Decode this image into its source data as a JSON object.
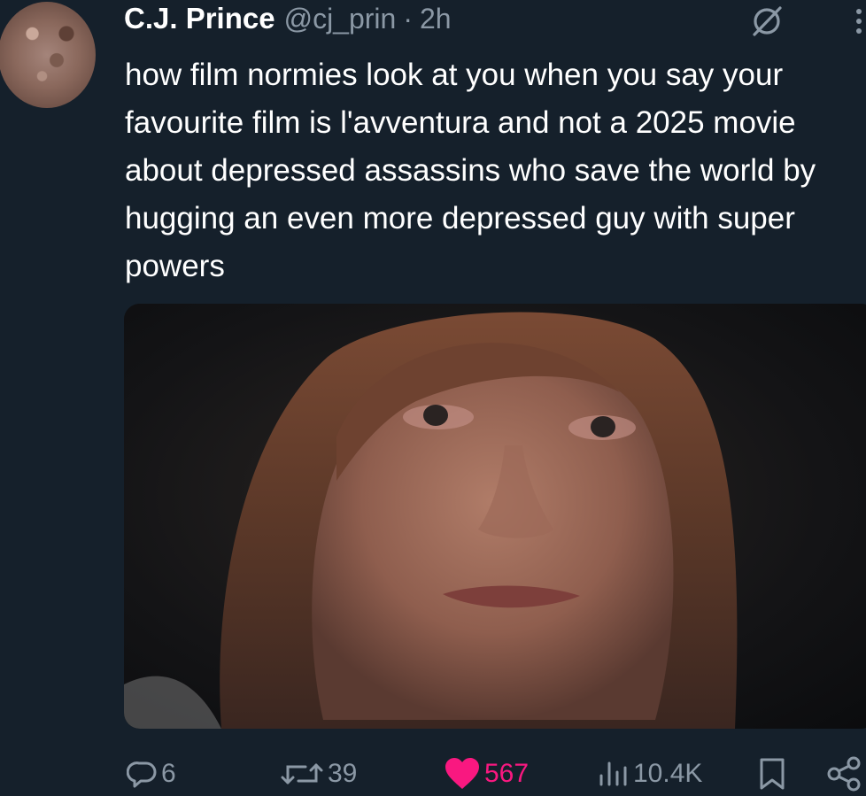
{
  "post": {
    "author_name": "C.J. Prince",
    "author_handle": "@cj_prin",
    "separator": "·",
    "timestamp": "2h",
    "text": "how film normies look at you when you say your favourite film is l'avventura and not a 2025 movie about depressed assassins who save the world by hugging an even more depressed guy with super powers"
  },
  "media": {
    "type": "image",
    "icon": "photo"
  },
  "actions": {
    "replies": "6",
    "reposts": "39",
    "likes": "567",
    "views": "10.4K",
    "liked": true
  },
  "colors": {
    "background": "#15202b",
    "text": "#ffffff",
    "muted": "#8b98a5",
    "like": "#f91880"
  },
  "icons": [
    "grok-icon",
    "more-icon",
    "reply-icon",
    "repost-icon",
    "like-icon",
    "views-icon",
    "bookmark-icon",
    "share-icon"
  ]
}
